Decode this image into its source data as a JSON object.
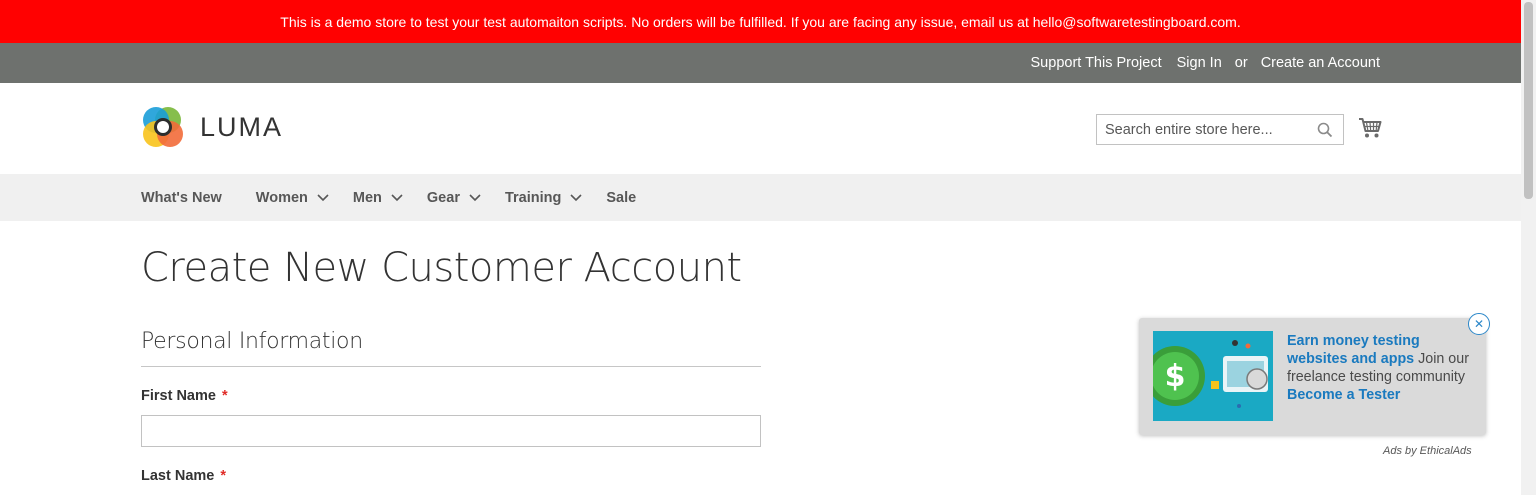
{
  "banner": {
    "text": "This is a demo store to test your test automaiton scripts. No orders will be fulfilled. If you are facing any issue, email us at hello@softwaretestingboard.com."
  },
  "top_links": {
    "support": "Support This Project",
    "sign_in": "Sign In",
    "or": "or",
    "create_account": "Create an Account"
  },
  "header": {
    "logo_text": "LUMA",
    "search_placeholder": "Search entire store here...",
    "search_icon": "search-icon",
    "cart_icon": "cart-icon"
  },
  "nav": {
    "items": [
      {
        "label": "What's New",
        "has_dropdown": false
      },
      {
        "label": "Women",
        "has_dropdown": true
      },
      {
        "label": "Men",
        "has_dropdown": true
      },
      {
        "label": "Gear",
        "has_dropdown": true
      },
      {
        "label": "Training",
        "has_dropdown": true
      },
      {
        "label": "Sale",
        "has_dropdown": false
      }
    ]
  },
  "page": {
    "title": "Create New Customer Account",
    "section_title": "Personal Information",
    "first_name_label": "First Name",
    "last_name_label": "Last Name",
    "required_marker": "*"
  },
  "ad": {
    "headline": "Earn money testing websites and apps",
    "body": " Join our freelance testing community ",
    "cta": "Become a Tester",
    "close_icon": "close-icon",
    "attribution": "Ads by EthicalAds"
  },
  "colors": {
    "banner_bg": "#ff0101",
    "top_links_bg": "#6e716e",
    "nav_bg": "#f0f0f0",
    "required": "#e02b27",
    "ad_link": "#1a7abf"
  }
}
